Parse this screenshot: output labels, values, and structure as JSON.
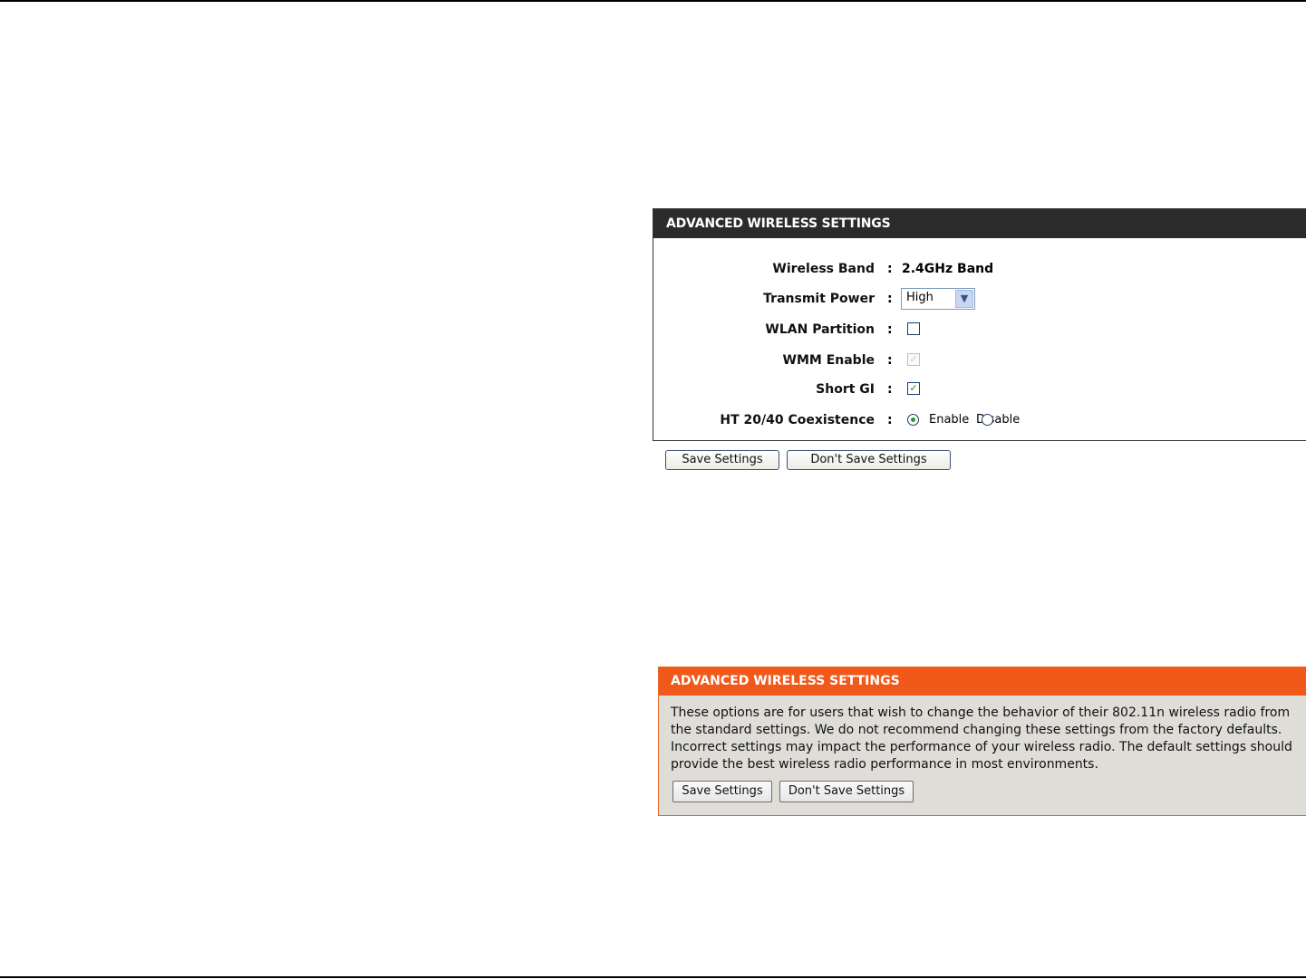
{
  "panel_top": {
    "title": "ADVANCED WIRELESS SETTINGS",
    "rows": {
      "wireless_band": {
        "label": "Wireless Band",
        "value": "2.4GHz Band"
      },
      "transmit_power": {
        "label": "Transmit Power",
        "value": "High"
      },
      "wlan_partition": {
        "label": "WLAN Partition",
        "checked": false
      },
      "wmm_enable": {
        "label": "WMM Enable",
        "checked": true,
        "disabled": true
      },
      "short_gi": {
        "label": "Short GI",
        "checked": true
      },
      "ht_coexistence": {
        "label": "HT 20/40 Coexistence",
        "enable_label": "Enable",
        "disable_label": "Disable",
        "selected": "Enable"
      }
    },
    "colon": ":",
    "save_label": "Save Settings",
    "dont_save_label": "Don't Save Settings"
  },
  "panel_help": {
    "title": "ADVANCED WIRELESS SETTINGS",
    "description": "These options are for users that wish to change the behavior of their 802.11n wireless radio from the standard settings. We do not recommend changing these settings from the factory defaults. Incorrect settings may impact the performance of your wireless radio. The default settings should provide the best wireless radio performance in most environments.",
    "save_label": "Save Settings",
    "dont_save_label": "Don't Save Settings"
  },
  "icons": {
    "dropdown": "chevron-down-icon",
    "check": "check-icon"
  },
  "colors": {
    "header_dark": "#2b2b2b",
    "header_orange": "#f0591a",
    "panel_bg": "#dfddd7"
  }
}
